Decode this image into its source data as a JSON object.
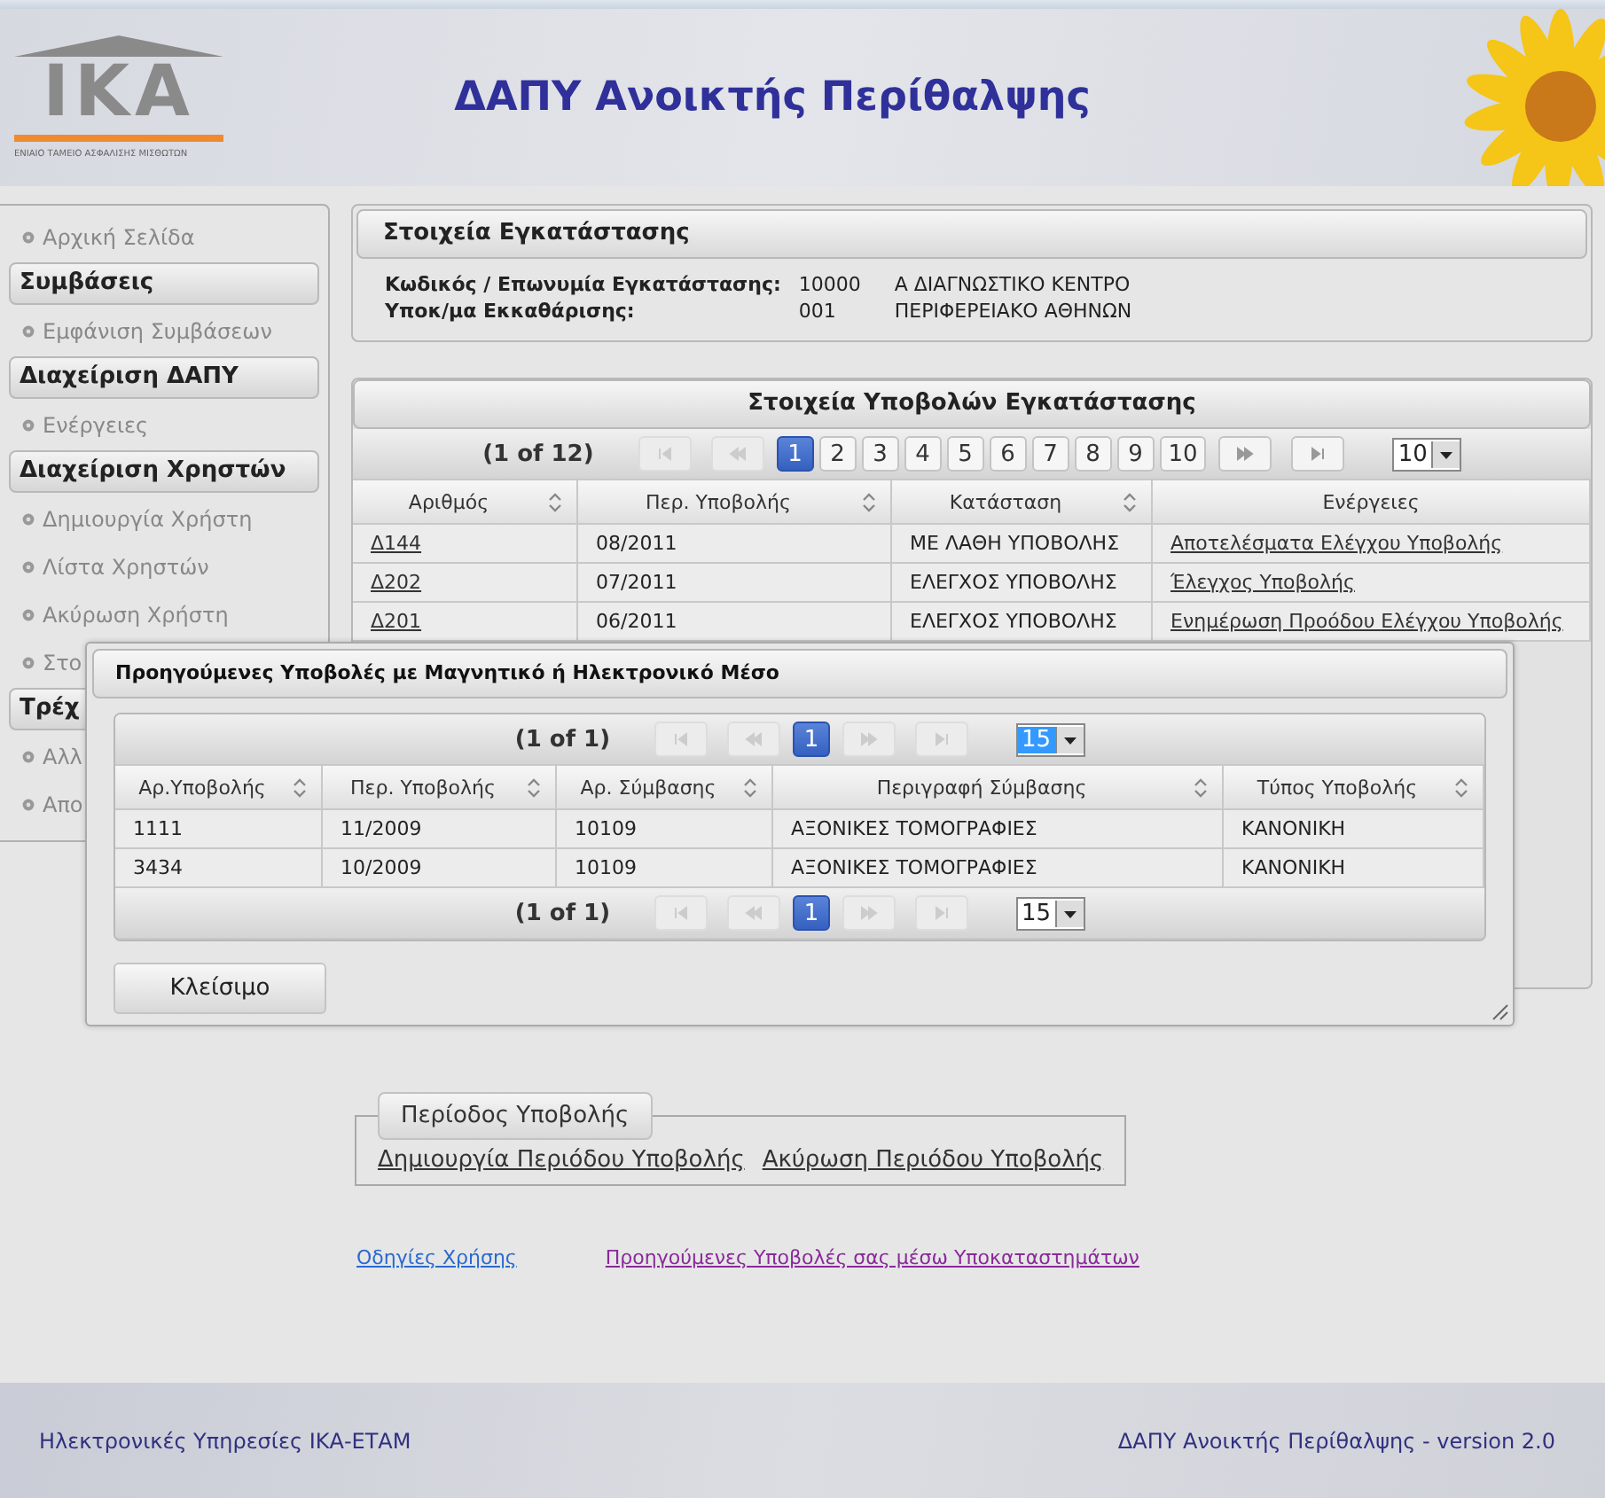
{
  "header": {
    "logo": {
      "letters": "IKA",
      "tagline": "ΕΝΙΑΙΟ ΤΑΜΕΙΟ ΑΣΦΑΛΙΣΗΣ ΜΙΣΘΩΤΩΝ"
    },
    "title": "ΔΑΠΥ Ανοικτής Περίθαλψης"
  },
  "sidebar": {
    "items": [
      {
        "kind": "link",
        "label": "Αρχική Σελίδα"
      },
      {
        "kind": "header",
        "label": "Συμβάσεις"
      },
      {
        "kind": "link",
        "label": "Εμφάνιση Συμβάσεων"
      },
      {
        "kind": "header",
        "label": "Διαχείριση ΔΑΠΥ"
      },
      {
        "kind": "link",
        "label": "Ενέργειες"
      },
      {
        "kind": "header",
        "label": "Διαχείριση Χρηστών"
      },
      {
        "kind": "link",
        "label": "Δημιουργία Χρήστη"
      },
      {
        "kind": "link",
        "label": "Λίστα Χρηστών"
      },
      {
        "kind": "link",
        "label": "Ακύρωση Χρήστη"
      },
      {
        "kind": "link",
        "label": "Στο"
      },
      {
        "kind": "header",
        "label": "Τρέχ"
      },
      {
        "kind": "link",
        "label": "Αλλ"
      },
      {
        "kind": "link",
        "label": "Απο"
      }
    ]
  },
  "installation": {
    "title": "Στοιχεία Εγκατάστασης",
    "fields": [
      {
        "label": "Κωδικός / Επωνυμία Εγκατάστασης:",
        "code": "10000",
        "name": "Α ΔΙΑΓΝΩΣΤΙΚΟ ΚΕΝΤΡΟ"
      },
      {
        "label": "Υποκ/μα Εκκαθάρισης:",
        "code": "001",
        "name": "ΠΕΡΙΦΕΡΕΙΑΚΟ ΑΘΗΝΩΝ"
      }
    ]
  },
  "submissions": {
    "title": "Στοιχεία Υποβολών Εγκατάστασης",
    "pager": {
      "summary": "(1 of 12)",
      "nav": [
        {
          "kind": "first",
          "disabled": true
        },
        {
          "kind": "prev",
          "disabled": true
        },
        {
          "kind": "next",
          "disabled": false
        },
        {
          "kind": "last",
          "disabled": false
        }
      ],
      "pages": [
        {
          "label": "1",
          "selected": true
        },
        {
          "label": "2",
          "selected": false
        },
        {
          "label": "3",
          "selected": false
        },
        {
          "label": "4",
          "selected": false
        },
        {
          "label": "5",
          "selected": false
        },
        {
          "label": "6",
          "selected": false
        },
        {
          "label": "7",
          "selected": false
        },
        {
          "label": "8",
          "selected": false
        },
        {
          "label": "9",
          "selected": false
        },
        {
          "label": "10",
          "selected": false
        }
      ],
      "page_size": {
        "value": "10",
        "focused": false
      }
    },
    "columns": [
      {
        "label": "Αριθμός",
        "sortable": true
      },
      {
        "label": "Περ. Υποβολής",
        "sortable": true
      },
      {
        "label": "Κατάσταση",
        "sortable": true
      },
      {
        "label": "Ενέργειες",
        "sortable": false
      }
    ],
    "rows": [
      {
        "number": "Δ144",
        "period": "08/2011",
        "status": "ΜΕ ΛΑΘΗ ΥΠΟΒΟΛΗΣ",
        "action": "Αποτελέσματα Ελέγχου Υποβολής"
      },
      {
        "number": "Δ202",
        "period": "07/2011",
        "status": "ΕΛΕΓΧΟΣ ΥΠΟΒΟΛΗΣ",
        "action": "Έλεγχος Υποβολής"
      },
      {
        "number": "Δ201",
        "period": "06/2011",
        "status": "ΕΛΕΓΧΟΣ ΥΠΟΒΟΛΗΣ",
        "action": "Ενημέρωση Προόδου Ελέγχου Υποβολής"
      }
    ]
  },
  "dialog": {
    "title": "Προηγούμενες Υποβολές με Μαγνητικό ή Ηλεκτρονικό Μέσο",
    "top_pager": {
      "summary": "(1 of 1)",
      "nav": [
        {
          "kind": "first",
          "disabled": true
        },
        {
          "kind": "prev",
          "disabled": true
        },
        {
          "kind": "next",
          "disabled": true
        },
        {
          "kind": "last",
          "disabled": true
        }
      ],
      "pages": [
        {
          "label": "1",
          "selected": true
        }
      ],
      "page_size": {
        "value": "15",
        "focused": true
      }
    },
    "columns": [
      {
        "label": "Αρ.Υποβολής",
        "sortable": true
      },
      {
        "label": "Περ. Υποβολής",
        "sortable": true
      },
      {
        "label": "Αρ. Σύμβασης",
        "sortable": true
      },
      {
        "label": "Περιγραφή Σύμβασης",
        "sortable": true
      },
      {
        "label": "Τύπος Υποβολής",
        "sortable": true
      }
    ],
    "rows": [
      [
        "1111",
        "11/2009",
        "10109",
        "ΑΞΟΝΙΚΕΣ ΤΟΜΟΓΡΑΦΙΕΣ",
        "ΚΑΝΟΝΙΚΗ"
      ],
      [
        "3434",
        "10/2009",
        "10109",
        "ΑΞΟΝΙΚΕΣ ΤΟΜΟΓΡΑΦΙΕΣ",
        "ΚΑΝΟΝΙΚΗ"
      ]
    ],
    "bottom_pager": {
      "summary": "(1 of 1)",
      "nav": [
        {
          "kind": "first",
          "disabled": true
        },
        {
          "kind": "prev",
          "disabled": true
        },
        {
          "kind": "next",
          "disabled": true
        },
        {
          "kind": "last",
          "disabled": true
        }
      ],
      "pages": [
        {
          "label": "1",
          "selected": true
        }
      ],
      "page_size": {
        "value": "15",
        "focused": false
      }
    },
    "close_button": "Κλείσιμο"
  },
  "period": {
    "legend": "Περίοδος Υποβολής",
    "links": [
      "Δημιουργία Περιόδου Υποβολής",
      "Ακύρωση Περιόδου Υποβολής"
    ]
  },
  "bottom_links": [
    {
      "label": "Οδηγίες Χρήσης",
      "visited": false
    },
    {
      "label": "Προηγούμενες Υποβολές σας μέσω Υποκαταστημάτων",
      "visited": true
    }
  ],
  "footer": {
    "left": "Ηλεκτρονικές Υπηρεσίες ΙΚΑ-ΕΤΑΜ",
    "right": "ΔΑΠΥ Ανοικτής Περίθαλψης - version 2.0"
  }
}
